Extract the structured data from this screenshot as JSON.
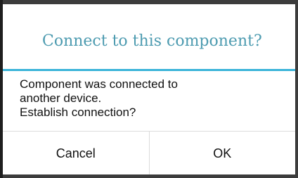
{
  "dialog": {
    "title": "Connect to this component?",
    "message_lines": [
      "Component was connected to",
      "another device.",
      "Establish connection?"
    ],
    "cancel_label": "Cancel",
    "ok_label": "OK"
  },
  "colors": {
    "title_text": "#4d9bb0",
    "title_divider": "#3ab4d9",
    "backdrop": "#3c3c3c"
  }
}
